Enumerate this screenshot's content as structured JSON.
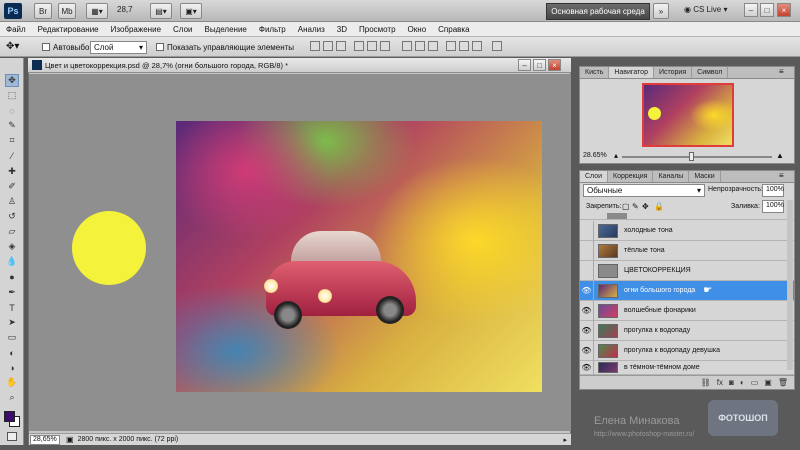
{
  "appbar": {
    "logo": "Ps",
    "zoom_value": "28,7",
    "workspace_label": "Основная рабочая среда",
    "workspace_more": "»",
    "cs_live": "CS Live",
    "window_controls": [
      "–",
      "□",
      "×"
    ]
  },
  "menu": {
    "items": [
      "Файл",
      "Редактирование",
      "Изображение",
      "Слои",
      "Выделение",
      "Фильтр",
      "Анализ",
      "3D",
      "Просмотр",
      "Окно",
      "Справка"
    ]
  },
  "options": {
    "autoselect_label": "Автовыбор:",
    "autoselect_value": "Слой",
    "show_controls_label": "Показать управляющие элементы"
  },
  "document": {
    "title": "Цвет и цветокоррекция.psd @ 28,7% (огни большого города, RGB/8) *",
    "zoom_status": "28,65%",
    "size_status": "2800 пикс. x 2000 пикс. (72 ppi)"
  },
  "navigator": {
    "tabs": [
      "Кисть",
      "Навигатор",
      "История",
      "Символ"
    ],
    "zoom": "28.65%"
  },
  "layers": {
    "tabs": [
      "Слои",
      "Коррекция",
      "Каналы",
      "Маски"
    ],
    "blend_mode": "Обычные",
    "opacity_label": "Непрозрачность:",
    "opacity_value": "100%",
    "lock_label": "Закрепить:",
    "fill_label": "Заливка:",
    "fill_value": "100%",
    "rows": [
      {
        "name": "холодные тона",
        "visible": false
      },
      {
        "name": "тёплые тона",
        "visible": false
      },
      {
        "name": "ЦВЕТОКОРРЕКЦИЯ",
        "visible": false
      },
      {
        "name": "огни большого города",
        "visible": true,
        "selected": true
      },
      {
        "name": "волшебные фонарики",
        "visible": true
      },
      {
        "name": "прогулка к водопаду",
        "visible": true
      },
      {
        "name": "прогулка к водопаду девушка",
        "visible": true
      },
      {
        "name": "в тёмном-тёмном доме",
        "visible": true
      }
    ],
    "footer_icons": [
      "link-icon",
      "fx-icon",
      "mask-icon",
      "adjustment-icon",
      "folder-icon",
      "new-layer-icon",
      "trash-icon"
    ]
  },
  "watermark": {
    "name": "Елена Минакова",
    "url": "http://www.photoshop-master.ru/",
    "logo_text": "ФОТОШОП"
  }
}
